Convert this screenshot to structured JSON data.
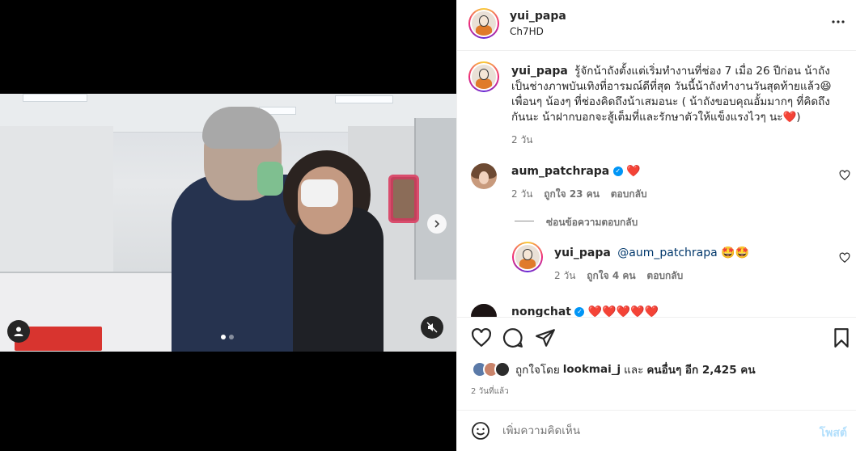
{
  "post": {
    "author": "yui_papa",
    "location": "Ch7HD",
    "more_icon": "more-horizontal-icon",
    "caption_text": "รู้จักน้าถังตั้งแต่เริ่มทำงานที่ช่อง 7 เมื่อ 26 ปีก่อน น้าถังเป็นช่างภาพบันเทิงที่อารมณ์ดีที่สุด วันนี้น้าถังทำงานวันสุดท้ายแล้ว😆 เพื่อนๆ น้องๆ ที่ช่องคิดถึงน้าเสมอนะ ( น้าถังขอบคุณอั้มมากๆ ที่คิดถึงกันนะ น้าฝากบอกจะสู้เต็มที่และรักษาตัวให้แข็งแรงไวๆ นะ❤️)",
    "caption_age": "2 วัน"
  },
  "comments": [
    {
      "user": "aum_patchrapa",
      "verified": true,
      "text": "❤️",
      "age": "2 วัน",
      "likes": "ถูกใจ 23 คน",
      "reply_label": "ตอบกลับ"
    }
  ],
  "hide_replies": "ซ่อนข้อความตอบกลับ",
  "reply": {
    "user": "yui_papa",
    "mention": "@aum_patchrapa",
    "text": "🤩🤩",
    "age": "2 วัน",
    "likes": "ถูกใจ 4 คน",
    "reply_label": "ตอบกลับ"
  },
  "partial_comment": {
    "user": "nongchat",
    "text": "❤️❤️❤️❤️❤️"
  },
  "liked_by": {
    "prefix": "ถูกใจโดย",
    "user": "lookmai_j",
    "middle": "และ",
    "others": "คนอื่นๆ อีก 2,425 คน"
  },
  "timestamp": "2 วันที่แล้ว",
  "comment_box": {
    "placeholder": "เพิ่มความคิดเห็น",
    "post_label": "โพสต์"
  },
  "icons": {
    "like": "heart-icon",
    "comment": "comment-icon",
    "share": "share-icon",
    "save": "bookmark-icon",
    "emoji": "emoji-icon",
    "user_tag": "user-tag-icon",
    "mute": "muted-speaker-icon",
    "next": "chevron-right-icon"
  },
  "carousel": {
    "count": 2,
    "active": 1
  }
}
